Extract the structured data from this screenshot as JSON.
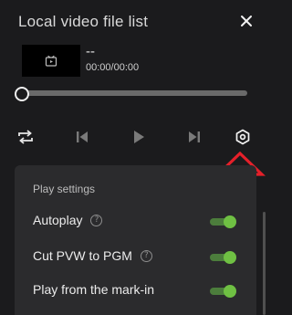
{
  "window": {
    "title": "Local video file list",
    "close_icon": "close-icon"
  },
  "file": {
    "name": "--",
    "time": "00:00/00:00",
    "thumbnail_icon": "video-file-icon"
  },
  "progress": {
    "fraction": 0.0
  },
  "controls": {
    "icons": [
      "repeat-icon",
      "previous-icon",
      "play-icon",
      "next-icon",
      "settings-icon"
    ]
  },
  "play_settings": {
    "title": "Play settings",
    "options": [
      {
        "label": "Autoplay",
        "help": "?",
        "enabled": true
      },
      {
        "label": "Cut PVW to PGM",
        "help": "?",
        "enabled": true
      },
      {
        "label": "Play from the mark-in",
        "enabled": true
      }
    ]
  },
  "colors": {
    "toggle_on": "#6fc043",
    "annotation_arrow": "#e5202a"
  }
}
